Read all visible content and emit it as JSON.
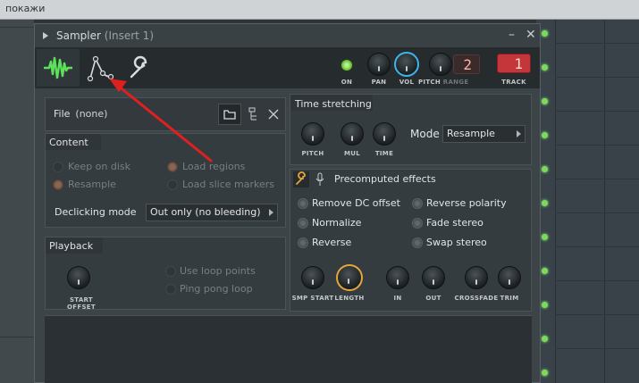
{
  "background": {
    "hint_text": "покажи"
  },
  "window": {
    "title": "Sampler",
    "subtitle": "(Insert 1)",
    "title_buttons": [
      "–",
      "✕"
    ]
  },
  "toolbar": {
    "tabs": [
      {
        "name": "waveform-tab",
        "icon": "waveform-icon"
      },
      {
        "name": "envelope-tab",
        "icon": "envelope-icon"
      },
      {
        "name": "settings-tab",
        "icon": "wrench-icon"
      }
    ],
    "on_label": "ON",
    "pan_label": "PAN",
    "vol_label": "VOL",
    "pitch_label": "PITCH",
    "range_label": "RANGE",
    "range_value": "2",
    "track_label": "TRACK",
    "track_value": "1"
  },
  "file": {
    "label": "File",
    "value": "(none)"
  },
  "content": {
    "title": "Content",
    "keep_on_disk": "Keep on disk",
    "resample": "Resample",
    "load_regions": "Load regions",
    "load_slice_markers": "Load slice markers",
    "declicking_label": "Declicking mode",
    "declicking_value": "Out only (no bleeding)"
  },
  "playback": {
    "title": "Playback",
    "start_offset": "START OFFSET",
    "use_loop_points": "Use loop points",
    "ping_pong_loop": "Ping pong loop"
  },
  "time_stretching": {
    "title": "Time stretching",
    "pitch": "PITCH",
    "mul": "MUL",
    "time": "TIME",
    "mode_label": "Mode",
    "mode_value": "Resample"
  },
  "precomputed": {
    "title": "Precomputed effects",
    "remove_dc": "Remove DC offset",
    "normalize": "Normalize",
    "reverse": "Reverse",
    "reverse_polarity": "Reverse polarity",
    "fade_stereo": "Fade stereo",
    "swap_stereo": "Swap stereo",
    "smp_start": "SMP START",
    "length": "LENGTH",
    "in": "IN",
    "out": "OUT",
    "crossfade": "CROSSFADE",
    "trim": "TRIM"
  },
  "colors": {
    "accent_green": "#5de05a",
    "annotation_red": "#e02020",
    "vol_knob_ring": "#3cb6e8",
    "length_knob_ring": "#e5a53a"
  }
}
